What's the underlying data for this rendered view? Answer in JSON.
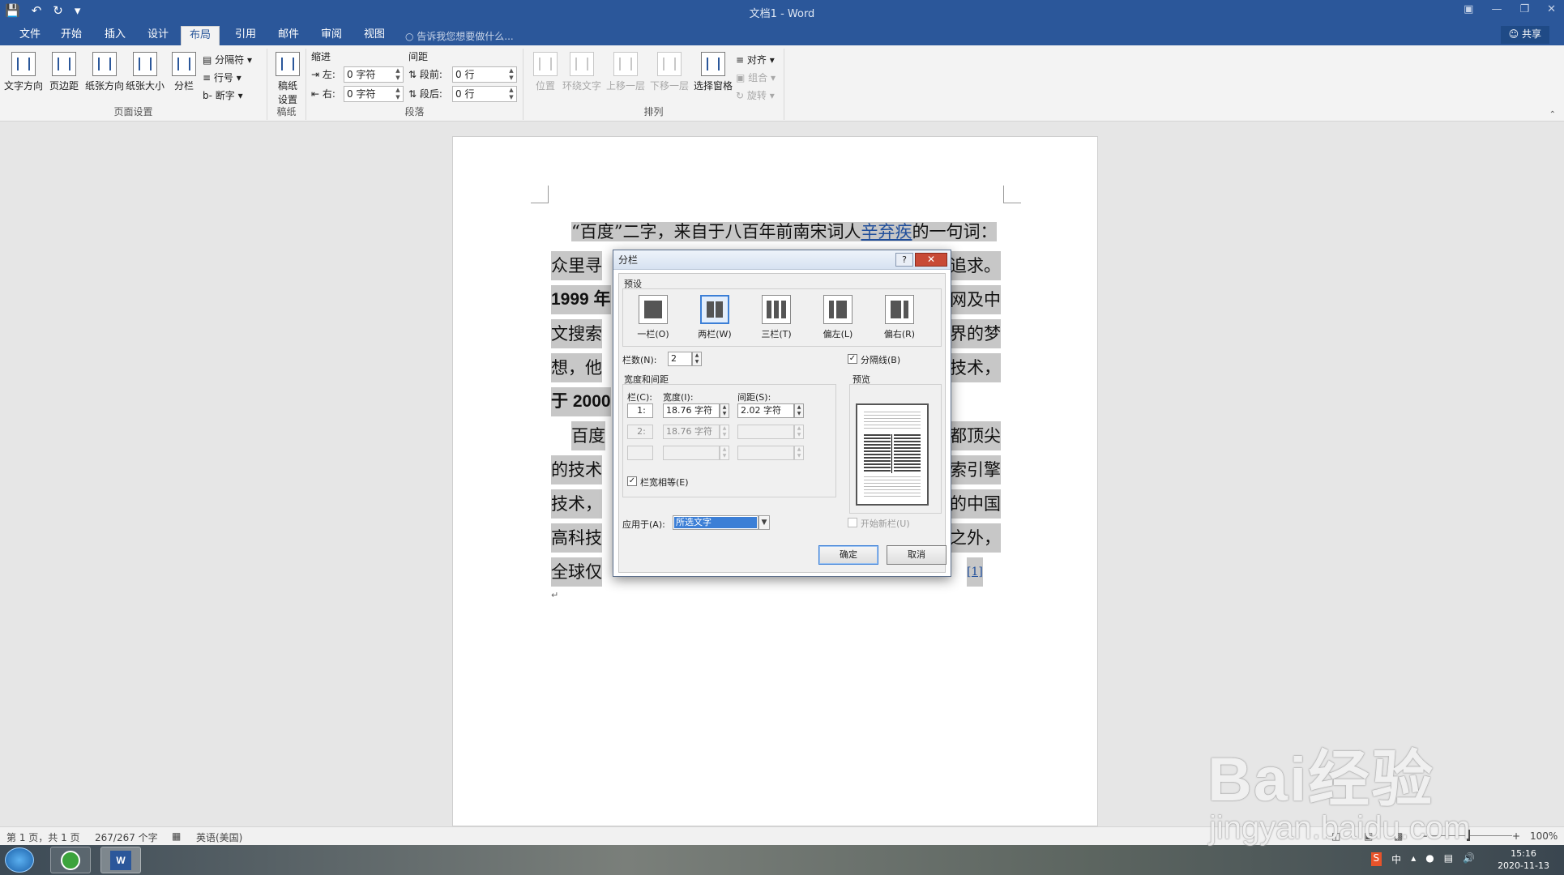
{
  "window": {
    "title": "文档1 - Word"
  },
  "quick_access": {
    "save_icon": "save-icon",
    "undo_icon": "undo-icon",
    "redo_icon": "redo-icon",
    "customize_icon": "customize-qat-icon"
  },
  "tabs": [
    {
      "label": "文件"
    },
    {
      "label": "开始"
    },
    {
      "label": "插入"
    },
    {
      "label": "设计"
    },
    {
      "label": "布局",
      "active": true
    },
    {
      "label": "引用"
    },
    {
      "label": "邮件"
    },
    {
      "label": "审阅"
    },
    {
      "label": "视图"
    }
  ],
  "tell_me": "告诉我您想要做什么...",
  "share": "共享",
  "ribbon": {
    "page_setup": {
      "group_label": "页面设置",
      "text_direction": "文字方向",
      "margins": "页边距",
      "orientation": "纸张方向",
      "size": "纸张大小",
      "columns": "分栏",
      "breaks": "分隔符",
      "line_numbers": "行号",
      "hyphenation": "断字"
    },
    "manuscript": {
      "group_label": "稿纸",
      "button_line1": "稿纸",
      "button_line2": "设置"
    },
    "paragraph": {
      "group_label": "段落",
      "indent_header": "缩进",
      "spacing_header": "间距",
      "left_label": "左:",
      "left_value": "0 字符",
      "right_label": "右:",
      "right_value": "0 字符",
      "before_label": "段前:",
      "before_value": "0 行",
      "after_label": "段后:",
      "after_value": "0 行"
    },
    "arrange": {
      "group_label": "排列",
      "position": "位置",
      "wrap_text": "环绕文字",
      "bring_forward": "上移一层",
      "send_backward": "下移一层",
      "selection_pane": "选择窗格",
      "align": "对齐",
      "group": "组合",
      "rotate": "旋转"
    }
  },
  "document": {
    "lines": [
      {
        "prefix": "“百度”二字，来自于八百年前南宋词人",
        "link": "辛弃疾",
        "suffix": "的一句词："
      },
      {
        "left": "众里寻",
        "right": "追求。"
      },
      {
        "left": "1999 年",
        "right": "网及中"
      },
      {
        "left": "文搜索",
        "right": "界的梦"
      },
      {
        "left": "想，他",
        "right": "技术，"
      },
      {
        "left": "于 2000",
        "right": ""
      },
      {
        "left": "百度",
        "right": "都顶尖"
      },
      {
        "left": "的技术",
        "right": "索引擎"
      },
      {
        "left": "技术，",
        "right": "的中国"
      },
      {
        "left": "高科技",
        "right": "之外，"
      },
      {
        "left": "全球仅",
        "right": "[1]"
      }
    ]
  },
  "dialog": {
    "title": "分栏",
    "help": "?",
    "close": "✕",
    "presets_header": "预设",
    "presets": [
      {
        "label": "一栏(O)"
      },
      {
        "label": "两栏(W)",
        "selected": true
      },
      {
        "label": "三栏(T)"
      },
      {
        "label": "偏左(L)"
      },
      {
        "label": "偏右(R)"
      }
    ],
    "num_columns_label": "栏数(N):",
    "num_columns_value": "2",
    "line_between_label": "分隔线(B)",
    "line_between_checked": "✓",
    "width_spacing_header": "宽度和间距",
    "col_header": "栏(C):",
    "width_header": "宽度(I):",
    "spacing_header": "间距(S):",
    "rows": [
      {
        "col": "1:",
        "width": "18.76 字符",
        "spacing": "2.02 字符"
      },
      {
        "col": "2:",
        "width": "18.76 字符",
        "spacing": ""
      },
      {
        "col": "",
        "width": "",
        "spacing": ""
      }
    ],
    "equal_width_label": "栏宽相等(E)",
    "equal_width_checked": "✓",
    "preview_label": "预览",
    "apply_to_label": "应用于(A):",
    "apply_to_value": "所选文字",
    "start_new_column_label": "开始新栏(U)",
    "ok": "确定",
    "cancel": "取消"
  },
  "statusbar": {
    "page": "第 1 页，共 1 页",
    "words": "267/267 个字",
    "language": "英语(美国)",
    "zoom": "100%"
  },
  "taskbar": {
    "time": "15:16",
    "date": "2020-11-13",
    "ime": "中"
  },
  "watermark": {
    "brand": "Bai经验",
    "url": "jingyan.baidu.com"
  }
}
